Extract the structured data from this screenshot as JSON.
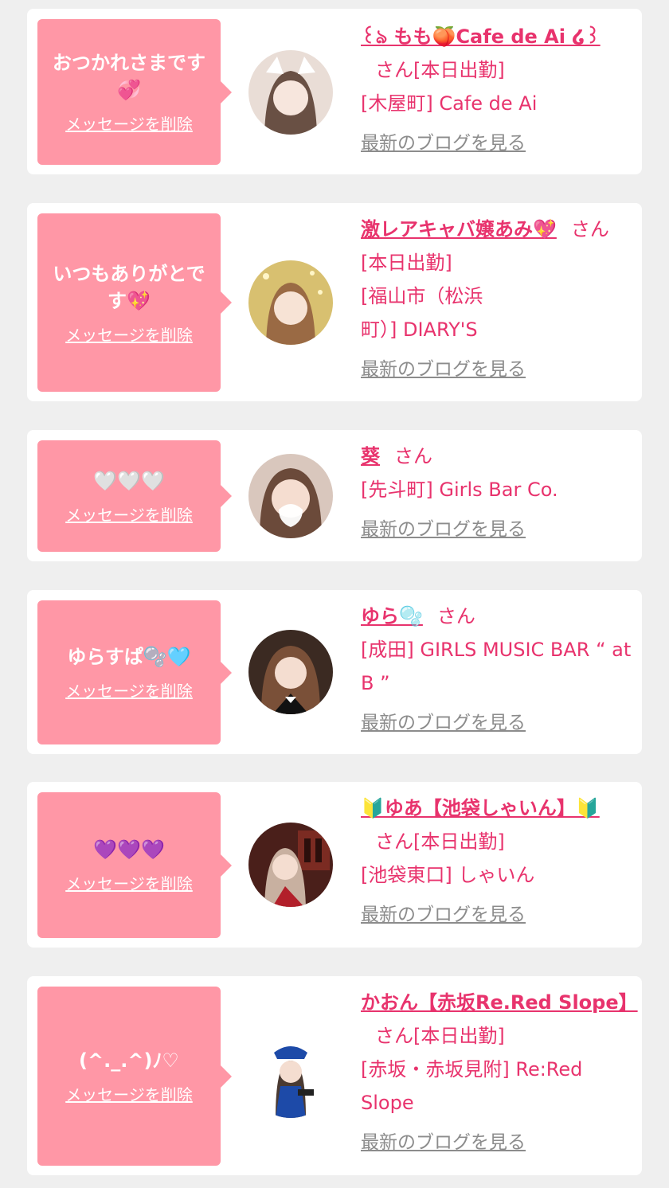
{
  "entries": [
    {
      "message": "おつかれさまです💞",
      "delete_label": "メッセージを削除",
      "name": "꒰ঌ もも🍑Cafe de Ai ໒꒱",
      "san": "さん",
      "status": "[本日出勤]",
      "shop": "[木屋町] Cafe de Ai",
      "blog_label": "最新のブログを見る"
    },
    {
      "message": "いつもありがとです💖",
      "delete_label": "メッセージを削除",
      "name": "激レアキャバ嬢あみ💖",
      "san": "さん",
      "status": "[本日出勤]",
      "shop": "[福山市（松浜町）] DIARY'S",
      "blog_label": "最新のブログを見る"
    },
    {
      "message": "🤍🤍🤍",
      "delete_label": "メッセージを削除",
      "name": "葵",
      "san": "さん",
      "status": "",
      "shop": "[先斗町] Girls Bar Co.",
      "blog_label": "最新のブログを見る"
    },
    {
      "message": "ゆらすぱ🫧🩵",
      "delete_label": "メッセージを削除",
      "name": "ゆら🫧",
      "san": "さん",
      "status": "",
      "shop": "[成田] GIRLS MUSIC BAR “ at B ”",
      "blog_label": "最新のブログを見る"
    },
    {
      "message": "💜💜💜",
      "delete_label": "メッセージを削除",
      "name": "🔰ゆあ【池袋しゃいん】🔰",
      "san": "さん",
      "status": "[本日出勤]",
      "shop": "[池袋東口] しゃいん",
      "blog_label": "最新のブログを見る"
    },
    {
      "message": "(^._.^)ﾉ♡",
      "delete_label": "メッセージを削除",
      "name": "かおん【赤坂Re.Red Slope】",
      "san": "さん",
      "status": "[本日出勤]",
      "shop": "[赤坂・赤坂見附] Re:Red Slope",
      "blog_label": "最新のブログを見る"
    }
  ],
  "colors": {
    "accent": "#e8336d",
    "bubble": "#ff97a6",
    "background": "#efefef",
    "link_gray": "#8c8c8c"
  }
}
